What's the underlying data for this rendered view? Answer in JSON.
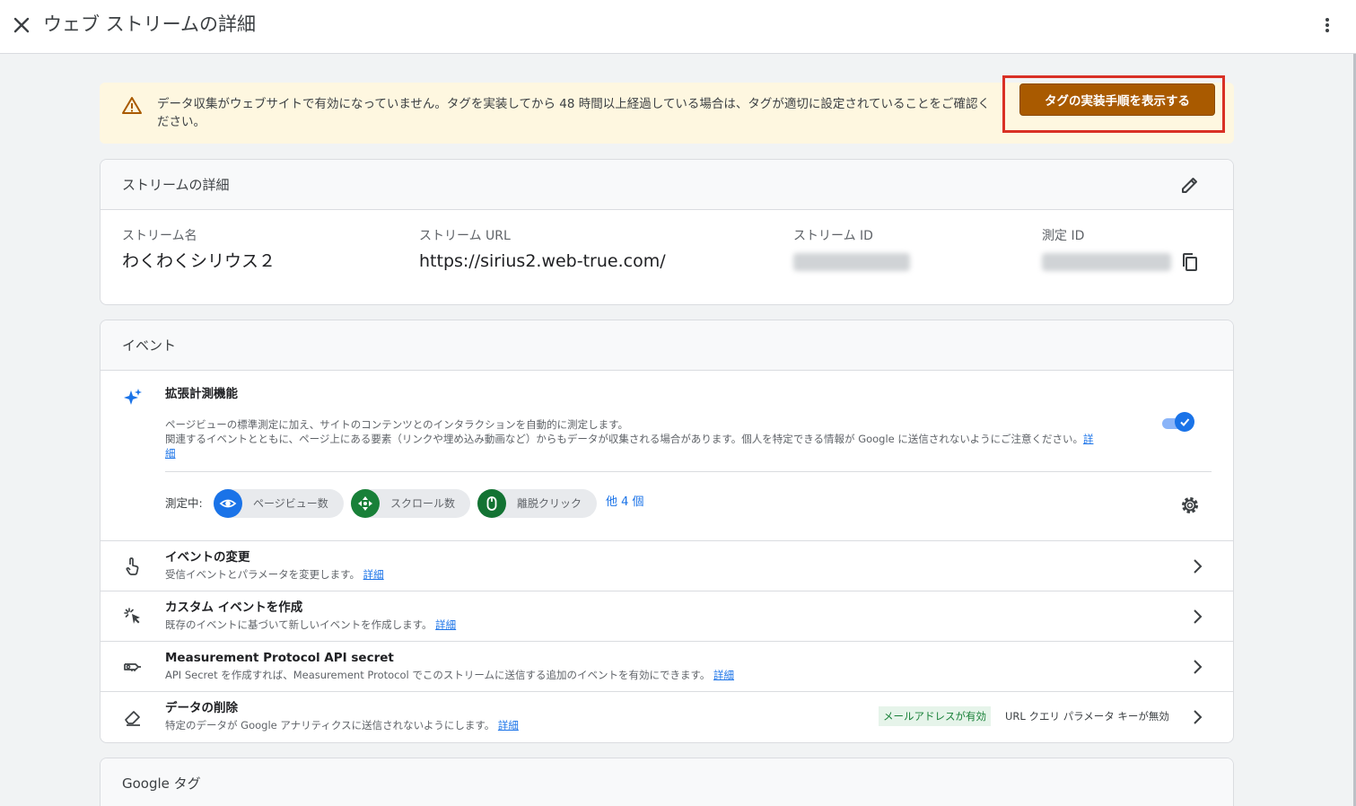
{
  "page": {
    "title": "ウェブ ストリームの詳細"
  },
  "banner": {
    "text": "データ収集がウェブサイトで有効になっていません。タグを実装してから 48 時間以上経過している場合は、タグが適切に設定されていることをご確認ください。",
    "button_label": "タグの実装手順を表示する"
  },
  "stream_details": {
    "title": "ストリームの詳細",
    "fields": [
      {
        "label": "ストリーム名",
        "value": "わくわくシリウス２"
      },
      {
        "label": "ストリーム URL",
        "value": "https://sirius2.web-true.com/"
      },
      {
        "label": "ストリーム ID"
      },
      {
        "label": "測定 ID"
      }
    ]
  },
  "events": {
    "title": "イベント",
    "enhanced": {
      "title": "拡張計測機能",
      "desc_line1": "ページビューの標準測定に加え、サイトのコンテンツとのインタラクションを自動的に測定します。",
      "desc_line2": "関連するイベントとともに、ページ上にある要素（リンクや埋め込み動画など）からもデータが収集される場合があります。個人を特定できる情報が Google に送信されないようにご注意ください。",
      "link_part1": "詳",
      "link_part2": "細",
      "enabled": true,
      "measuring_label": "測定中:",
      "chips": [
        {
          "label": "ページビュー数",
          "icon": "eye-icon",
          "color": "#1a73e8"
        },
        {
          "label": "スクロール数",
          "icon": "scroll-arrows-icon",
          "color": "#188038"
        },
        {
          "label": "離脱クリック",
          "icon": "mouse-icon",
          "color": "#137333"
        }
      ],
      "more": "他 4 個"
    },
    "rows": [
      {
        "title": "イベントの変更",
        "desc": "受信イベントとパラメータを変更します。",
        "link": "詳細",
        "icon": "touch-hand-icon"
      },
      {
        "title": "カスタム イベントを作成",
        "desc": "既存のイベントに基づいて新しいイベントを作成します。",
        "link": "詳細",
        "icon": "sparkle-click-icon"
      },
      {
        "title": "Measurement Protocol API secret",
        "desc": "API Secret を作成すれば、Measurement Protocol でこのストリームに送信する追加のイベントを有効にできます。",
        "link": "詳細",
        "icon": "key-icon"
      },
      {
        "title": "データの削除",
        "desc": "特定のデータが Google アナリティクスに送信されないようにします。",
        "link": "詳細",
        "icon": "eraser-icon",
        "status_enabled": "メールアドレスが有効",
        "status_disabled": "URL クエリ パラメータ キーが無効"
      }
    ]
  },
  "google_tag": {
    "title": "Google タグ"
  },
  "colors": {
    "accent": "#1a73e8",
    "banner_bg": "#fef7e0",
    "button": "#a95a00",
    "highlight": "#d93025",
    "status_green": "#188038"
  }
}
